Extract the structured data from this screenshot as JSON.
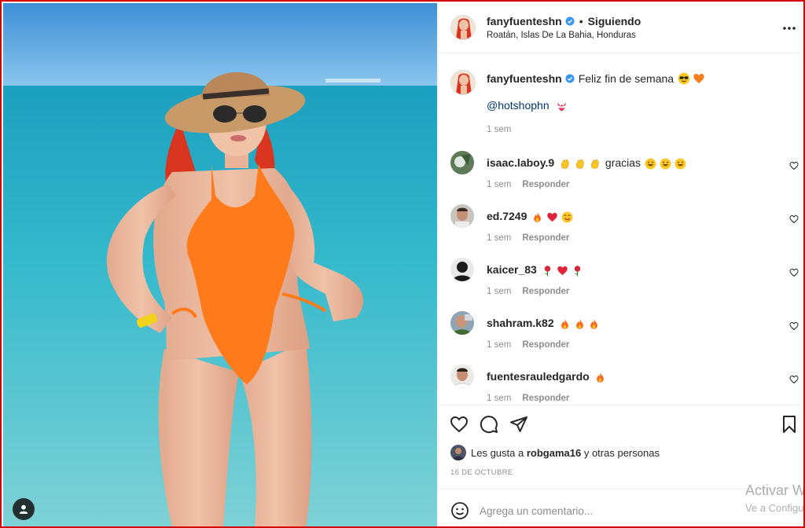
{
  "header": {
    "username": "fanyfuenteshn",
    "separator": "•",
    "follow_status": "Siguiendo",
    "location": "Roatán, Islas De La Bahia, Honduras"
  },
  "caption": {
    "username": "fanyfuenteshn",
    "text": "Feliz fin de semana",
    "emojis": [
      "sunglasses-face",
      "orange-heart"
    ],
    "mention": "@hotshophn",
    "mention_emoji": "bikini",
    "time": "1 sem"
  },
  "comments": [
    {
      "username": "isaac.laboy.9",
      "text": "gracias",
      "pre_emojis": [
        "clapping-hands",
        "clapping-hands",
        "clapping-hands"
      ],
      "post_emojis": [
        "grinning-face",
        "grinning-face",
        "grinning-face"
      ],
      "time": "1 sem",
      "reply_label": "Responder"
    },
    {
      "username": "ed.7249",
      "text": "",
      "pre_emojis": [
        "fire",
        "red-heart",
        "savoring-face"
      ],
      "post_emojis": [],
      "time": "1 sem",
      "reply_label": "Responder"
    },
    {
      "username": "kaicer_83",
      "text": "",
      "pre_emojis": [
        "rose",
        "red-heart",
        "rose"
      ],
      "post_emojis": [],
      "time": "1 sem",
      "reply_label": "Responder"
    },
    {
      "username": "shahram.k82",
      "text": "",
      "pre_emojis": [
        "fire",
        "fire",
        "fire"
      ],
      "post_emojis": [],
      "time": "1 sem",
      "reply_label": "Responder"
    },
    {
      "username": "fuentesrauledgardo",
      "text": "",
      "pre_emojis": [
        "fire"
      ],
      "post_emojis": [],
      "time": "1 sem",
      "reply_label": "Responder"
    }
  ],
  "likes": {
    "prefix": "Les gusta a",
    "user": "robgama16",
    "suffix": "y otras personas"
  },
  "date": "16 DE OCTUBRE",
  "add_comment": {
    "placeholder": "Agrega un comentario..."
  },
  "watermark": {
    "title": "Activar W",
    "subtitle": "Ve a Configu"
  },
  "colors": {
    "link": "#00376b",
    "verified": "#3897f0",
    "muted": "#8e8e8e",
    "frame": "#d60000",
    "swimsuit": "#ff7a1a"
  }
}
